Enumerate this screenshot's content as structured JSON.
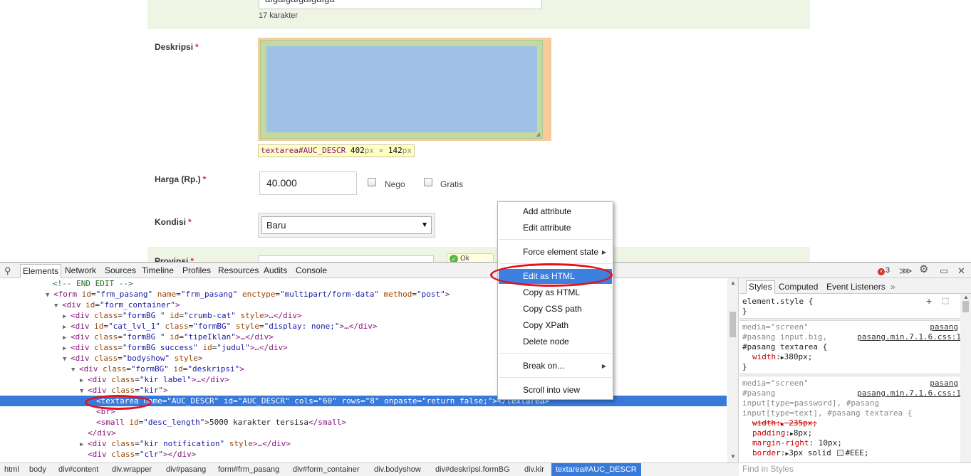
{
  "page": {
    "char_count": "17 karakter",
    "top_input_value": "afgafgafgafgafga",
    "description_label": "Deskripsi",
    "required_mark": "*",
    "textarea_tooltip": {
      "selector": "textarea#AUC_DESCR",
      "width": "402",
      "height": "142",
      "unit": "px",
      "times": "×"
    },
    "price_label": "Harga (Rp.)",
    "price_value": "40.000",
    "nego_label": "Nego",
    "gratis_label": "Gratis",
    "condition_label": "Kondisi",
    "condition_value": "Baru",
    "bottom_label": "Provinsi",
    "bottom_notif": "Ok"
  },
  "devtools": {
    "tabs": [
      "Elements",
      "Network",
      "Sources",
      "Timeline",
      "Profiles",
      "Resources",
      "Audits",
      "Console"
    ],
    "error_count": "3",
    "dom": {
      "l0": "<!-- END EDIT -->",
      "l1_tag": "<form",
      "l1_a1": "id",
      "l1_v1": "\"frm_pasang\"",
      "l1_a2": "name",
      "l1_v2": "\"frm_pasang\"",
      "l1_a3": "enctype",
      "l1_v3": "\"multipart/form-data\"",
      "l1_a4": "method",
      "l1_v4": "\"post\"",
      "l1_end": ">",
      "l2_tag": "<div",
      "l2_a1": "id",
      "l2_v1": "\"form_container\"",
      "l2_end": ">",
      "l3_tag": "<div",
      "l3_a1": "class",
      "l3_v1": "\"formBG \"",
      "l3_a2": "id",
      "l3_v2": "\"crumb-cat\"",
      "l3_a3": "style",
      "l3_end": ">…</div>",
      "l4_tag": "<div",
      "l4_a1": "id",
      "l4_v1": "\"cat_lvl_1\"",
      "l4_a2": "class",
      "l4_v2": "\"formBG\"",
      "l4_a3": "style",
      "l4_v3": "\"display: none;\"",
      "l4_end": ">…</div>",
      "l5_tag": "<div",
      "l5_a1": "class",
      "l5_v1": "\"formBG \"",
      "l5_a2": "id",
      "l5_v2": "\"tipeIklan\"",
      "l5_end": ">…</div>",
      "l6_tag": "<div",
      "l6_a1": "class",
      "l6_v1": "\"formBG success\"",
      "l6_a2": "id",
      "l6_v2": "\"judul\"",
      "l6_end": ">…</div>",
      "l7_tag": "<div",
      "l7_a1": "class",
      "l7_v1": "\"bodyshow\"",
      "l7_a2": "style",
      "l7_end": ">",
      "l8_tag": "<div",
      "l8_a1": "class",
      "l8_v1": "\"formBG\"",
      "l8_a2": "id",
      "l8_v2": "\"deskripsi\"",
      "l8_end": ">",
      "l9_tag": "<div",
      "l9_a1": "class",
      "l9_v1": "\"kir label\"",
      "l9_end": ">…</div>",
      "l10_tag": "<div",
      "l10_a1": "class",
      "l10_v1": "\"kir\"",
      "l10_end": ">",
      "l11_tag": "<textarea",
      "l11_a1": "name",
      "l11_v1": "\"AUC_DESCR\"",
      "l11_a2": "id",
      "l11_v2": "\"AUC_DESCR\"",
      "l11_a3": "cols",
      "l11_v3": "\"60\"",
      "l11_a4": "rows",
      "l11_v4": "\"8\"",
      "l11_a5": "onpaste",
      "l11_v5": "\"return false;\"",
      "l11_end": "></textarea>",
      "l12": "<br>",
      "l13_tag": "<small",
      "l13_a1": "id",
      "l13_v1": "\"desc_length\"",
      "l13_text": "5000 karakter tersisa",
      "l13_close": "</small>",
      "l14": "</div>",
      "l15_tag": "<div",
      "l15_a1": "class",
      "l15_v1": "\"kir notification\"",
      "l15_a2": "style",
      "l15_end": ">…</div>",
      "l16_tag": "<div",
      "l16_a1": "class",
      "l16_v1": "\"clr\"",
      "l16_end": "></div>"
    },
    "side_tabs": [
      "Styles",
      "Computed",
      "Event Listeners"
    ],
    "styles": {
      "element_style": "element.style {",
      "close_brace": "}",
      "media1": "media=\"screen\"",
      "src1a": "pasang",
      "sel1a": "#pasang input.big,",
      "src1b": "pasang.min.7.1.6.css:1",
      "sel1b": "#pasang textarea {",
      "p1_name": "width",
      "p1_val": "380px;",
      "media2": "media=\"screen\"",
      "src2a": "pasang",
      "sel2a": "#pasang",
      "src2b": "pasang.min.7.1.6.css:1",
      "sel2b": "input[type=password], #pasang",
      "sel2c": "input[type=text], #pasang textarea {",
      "p2_name": "width",
      "p2_val": "235px;",
      "p3_name": "padding",
      "p3_val": "8px;",
      "p4_name": "margin-right",
      "p4_val": "10px;",
      "p5_name": "border",
      "p5_val1": "3px solid",
      "p5_val2": "#EEE;"
    },
    "find_placeholder": "Find in Styles",
    "breadcrumbs": [
      "html",
      "body",
      "div#content",
      "div.wrapper",
      "div#pasang",
      "form#frm_pasang",
      "div#form_container",
      "div.bodyshow",
      "div#deskripsi.formBG",
      "div.kir",
      "textarea#AUC_DESCR"
    ]
  },
  "context_menu": {
    "items": [
      "Add attribute",
      "Edit attribute",
      "Force element state",
      "Edit as HTML",
      "Copy as HTML",
      "Copy CSS path",
      "Copy XPath",
      "Delete node",
      "Break on...",
      "Scroll into view"
    ],
    "highlighted": "Edit as HTML"
  },
  "colors": {
    "selection": "#3879d9",
    "menu_highlight": "#3d80df",
    "annotation": "#e3101e",
    "form_bg": "#eef5e4"
  }
}
